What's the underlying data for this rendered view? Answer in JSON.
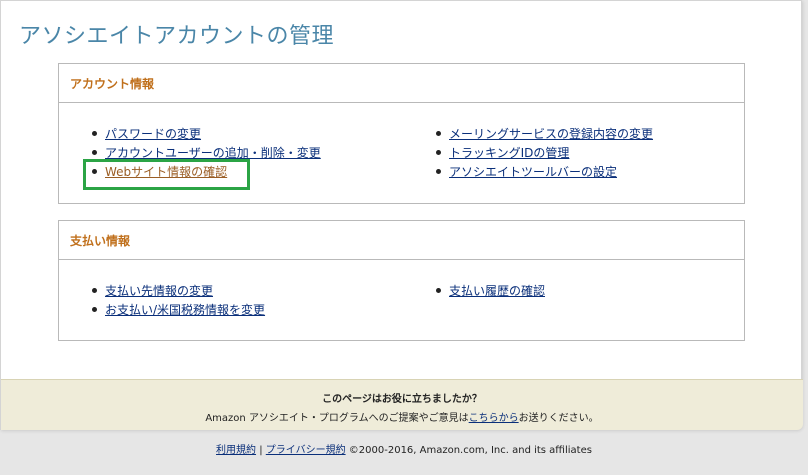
{
  "page": {
    "title": "アソシエイトアカウントの管理"
  },
  "account_section": {
    "header": "アカウント情報",
    "left_links": [
      {
        "label": "パスワードの変更"
      },
      {
        "label": "アカウントユーザーの追加・削除・変更"
      },
      {
        "label": "Webサイト情報の確認"
      }
    ],
    "right_links": [
      {
        "label": "メーリングサービスの登録内容の変更"
      },
      {
        "label": "トラッキングIDの管理"
      },
      {
        "label": "アソシエイトツールバーの設定"
      }
    ]
  },
  "payment_section": {
    "header": "支払い情報",
    "left_links": [
      {
        "label": "支払い先情報の変更"
      },
      {
        "label": "お支払い/米国税務情報を変更"
      }
    ],
    "right_links": [
      {
        "label": "支払い履歴の確認"
      }
    ]
  },
  "feedback": {
    "question": "このページはお役に立ちましたか？",
    "text_before": "Amazon アソシエイト・プログラムへのご提案やご意見は",
    "link": "こちらから",
    "text_after": "お送りください。"
  },
  "footer": {
    "terms": "利用規約",
    "separator": "|",
    "privacy": "プライバシー規約",
    "copyright": "©2000-2016, Amazon.com, Inc. and its affiliates"
  },
  "colors": {
    "title": "#4a86a8",
    "section_header": "#c0701c",
    "link": "#0a2f7a",
    "visited_link": "#9a5d24",
    "highlight": "#2ba445",
    "feedback_bg": "#efecd9"
  }
}
